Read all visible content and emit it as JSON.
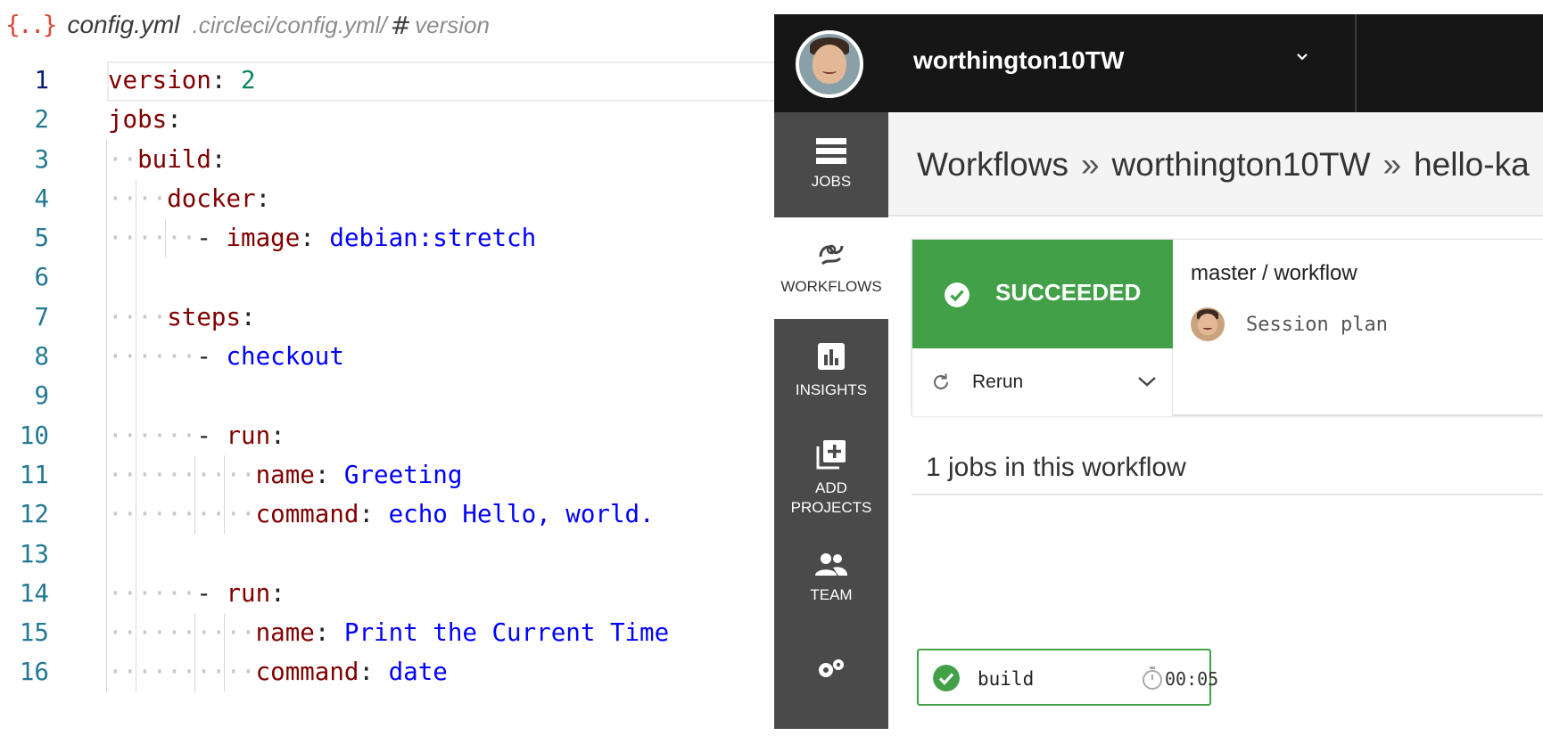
{
  "editor": {
    "breadcrumb": {
      "icon": "json-braces-icon",
      "file": "config.yml",
      "path": ".circleci/config.yml/",
      "symbol_icon": "hash-symbol-icon",
      "symbol": "version"
    },
    "lines": [
      {
        "num": "1",
        "ws": "",
        "key": "version",
        "sep": ":",
        "value": " 2",
        "value_kind": "number"
      },
      {
        "num": "2",
        "ws": "",
        "key": "jobs",
        "sep": ":",
        "value": "",
        "value_kind": ""
      },
      {
        "num": "3",
        "ws": "··",
        "key": "build",
        "sep": ":",
        "value": "",
        "value_kind": ""
      },
      {
        "num": "4",
        "ws": "····",
        "key": "docker",
        "sep": ":",
        "value": "",
        "value_kind": ""
      },
      {
        "num": "5",
        "ws": "······",
        "dash": "- ",
        "key": "image",
        "sep": ":",
        "value": " debian:stretch",
        "value_kind": "string"
      },
      {
        "num": "6",
        "ws": "",
        "key": "",
        "sep": "",
        "value": "",
        "value_kind": ""
      },
      {
        "num": "7",
        "ws": "····",
        "key": "steps",
        "sep": ":",
        "value": "",
        "value_kind": ""
      },
      {
        "num": "8",
        "ws": "······",
        "dash": "- ",
        "key": "",
        "sep": "",
        "value": "checkout",
        "value_kind": "string"
      },
      {
        "num": "9",
        "ws": "",
        "key": "",
        "sep": "",
        "value": "",
        "value_kind": ""
      },
      {
        "num": "10",
        "ws": "······",
        "dash": "- ",
        "key": "run",
        "sep": ":",
        "value": "",
        "value_kind": ""
      },
      {
        "num": "11",
        "ws": "··········",
        "key": "name",
        "sep": ":",
        "value": " Greeting",
        "value_kind": "string"
      },
      {
        "num": "12",
        "ws": "··········",
        "key": "command",
        "sep": ":",
        "value": " echo Hello, world.",
        "value_kind": "string"
      },
      {
        "num": "13",
        "ws": "",
        "key": "",
        "sep": "",
        "value": "",
        "value_kind": ""
      },
      {
        "num": "14",
        "ws": "······",
        "dash": "- ",
        "key": "run",
        "sep": ":",
        "value": "",
        "value_kind": ""
      },
      {
        "num": "15",
        "ws": "··········",
        "key": "name",
        "sep": ":",
        "value": " Print the Current Time",
        "value_kind": "string"
      },
      {
        "num": "16",
        "ws": "··········",
        "key": "command",
        "sep": ":",
        "value": " date",
        "value_kind": "string"
      }
    ],
    "active_line": "1",
    "colors": {
      "key": "#800000",
      "string": "#0000ff",
      "number": "#098658",
      "line_number": "#237893"
    }
  },
  "ci": {
    "org_name": "worthington10TW",
    "org_chevron_icon": "chevron-down-icon",
    "sidebar": [
      {
        "id": "jobs",
        "label": "JOBS",
        "icon": "jobs-list-icon"
      },
      {
        "id": "workflows",
        "label": "WORKFLOWS",
        "icon": "workflows-icon",
        "active": true
      },
      {
        "id": "insights",
        "label": "INSIGHTS",
        "icon": "bar-chart-icon"
      },
      {
        "id": "add-projects",
        "label_line1": "ADD",
        "label_line2": "PROJECTS",
        "icon": "add-box-icon"
      },
      {
        "id": "team",
        "label": "TEAM",
        "icon": "team-icon"
      },
      {
        "id": "settings",
        "label": "",
        "icon": "gears-icon"
      }
    ],
    "breadcrumb": {
      "part1": "Workflows",
      "sep": "»",
      "part2": "worthington10TW",
      "part3": "hello-ka"
    },
    "workflow": {
      "status": "SUCCEEDED",
      "status_color": "#42a048",
      "rerun_label": "Rerun",
      "branch": "master / workflow",
      "commit": "Session plan"
    },
    "jobs_count_text": "1 jobs in this workflow",
    "job": {
      "name": "build",
      "duration": "00:05"
    }
  }
}
